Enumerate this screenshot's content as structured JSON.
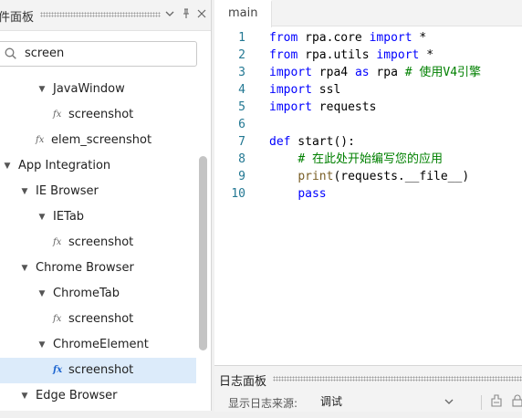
{
  "left_panel": {
    "title": "件面板",
    "search": {
      "value": "screen",
      "placeholder": ""
    },
    "tree": [
      {
        "label": "JavaWindow",
        "kind": "group",
        "level": 2
      },
      {
        "label": "screenshot",
        "kind": "function",
        "level": 3
      },
      {
        "label": "elem_screenshot",
        "kind": "function",
        "level": 2
      },
      {
        "label": "App Integration",
        "kind": "group",
        "level": 0
      },
      {
        "label": "IE Browser",
        "kind": "group",
        "level": 1
      },
      {
        "label": "IETab",
        "kind": "group",
        "level": 2
      },
      {
        "label": "screenshot",
        "kind": "function",
        "level": 3
      },
      {
        "label": "Chrome Browser",
        "kind": "group",
        "level": 1
      },
      {
        "label": "ChromeTab",
        "kind": "group",
        "level": 2
      },
      {
        "label": "screenshot",
        "kind": "function",
        "level": 3
      },
      {
        "label": "ChromeElement",
        "kind": "group",
        "level": 2
      },
      {
        "label": "screenshot",
        "kind": "function",
        "level": 3,
        "selected": true
      },
      {
        "label": "Edge Browser",
        "kind": "group",
        "level": 1
      }
    ]
  },
  "editor": {
    "tab_label": "main",
    "lines": [
      {
        "num": "1",
        "tokens": [
          {
            "t": "from",
            "c": "kw"
          },
          {
            "t": " rpa.core "
          },
          {
            "t": "import",
            "c": "kw"
          },
          {
            "t": " *"
          }
        ]
      },
      {
        "num": "2",
        "tokens": [
          {
            "t": "from",
            "c": "kw"
          },
          {
            "t": " rpa.utils "
          },
          {
            "t": "import",
            "c": "kw"
          },
          {
            "t": " *"
          }
        ]
      },
      {
        "num": "3",
        "tokens": [
          {
            "t": "import",
            "c": "kw"
          },
          {
            "t": " rpa4 "
          },
          {
            "t": "as",
            "c": "kw"
          },
          {
            "t": " rpa "
          },
          {
            "t": "# 使用V4引擎",
            "c": "cm"
          }
        ]
      },
      {
        "num": "4",
        "tokens": [
          {
            "t": "import",
            "c": "kw"
          },
          {
            "t": " ssl"
          }
        ]
      },
      {
        "num": "5",
        "tokens": [
          {
            "t": "import",
            "c": "kw"
          },
          {
            "t": " requests"
          }
        ]
      },
      {
        "num": "6",
        "tokens": []
      },
      {
        "num": "7",
        "tokens": [
          {
            "t": "def",
            "c": "kw"
          },
          {
            "t": " start():"
          }
        ]
      },
      {
        "num": "8",
        "tokens": [
          {
            "t": "    "
          },
          {
            "t": "# 在此处开始编写您的应用",
            "c": "cm"
          }
        ]
      },
      {
        "num": "9",
        "tokens": [
          {
            "t": "    "
          },
          {
            "t": "print",
            "c": "fn"
          },
          {
            "t": "(requests.__file__)"
          }
        ]
      },
      {
        "num": "10",
        "tokens": [
          {
            "t": "    "
          },
          {
            "t": "pass",
            "c": "kw"
          }
        ]
      }
    ]
  },
  "log_panel": {
    "title": "日志面板",
    "source_label": "显示日志来源:",
    "source_value": "调试"
  },
  "colors": {
    "keyword": "#0000ff",
    "comment": "#008000",
    "line_number": "#237893",
    "selection": "#dcebfa",
    "function_icon_active": "#1e66d0"
  }
}
